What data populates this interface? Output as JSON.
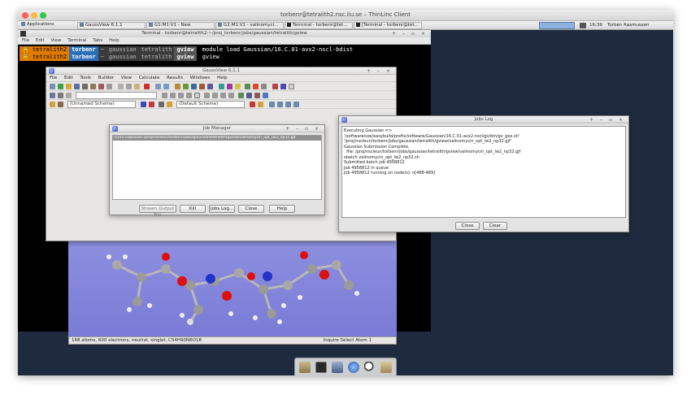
{
  "mac_window": {
    "title": "torbenr@tetralith2.nsc.liu.se – ThinLinc Client"
  },
  "taskbar": {
    "applications": "Applications",
    "tasks": [
      "GaussView 6.1.1",
      "G1:M1:V1 - New",
      "G2:M1:V1 - valinomyci...",
      "Terminal - torbenr@tet...",
      "[Terminal - torbenr@tet..."
    ],
    "clock": "16:39",
    "user": "Torben Rasmussen"
  },
  "terminal": {
    "title": "Terminal - torbenr@tetralith2:~/proj_torbenr/jobs/gaussian/tetralith/gview",
    "menu": [
      "File",
      "Edit",
      "View",
      "Terminal",
      "Tabs",
      "Help"
    ],
    "prompt": {
      "host": "tetralith2",
      "user": "torbenr",
      "tilde": "~",
      "path": [
        "gaussian",
        "tetralith",
        "gview"
      ]
    },
    "lines": [
      "module load Gaussian/16.C.01-avx2-nscl-bdist",
      "gview"
    ],
    "colors": {
      "host": "#e07b00",
      "user": "#2a6fb8",
      "path": "#4a4a4a"
    }
  },
  "gaussview": {
    "title": "GaussView 6.1.1",
    "menu": [
      "File",
      "Edit",
      "Tools",
      "Builder",
      "View",
      "Calculate",
      "Results",
      "Windows",
      "Help"
    ],
    "scheme_left": "(Unnamed Scheme)",
    "scheme_right": "(Default Scheme)"
  },
  "job_manager": {
    "title": "Job Manager",
    "row": "6315  Gaussian /proj/nscleun/torbenr/jobs/gaussian/tetralith/gview/valinomycin_opt_lw2_np32.gjf",
    "buttons": [
      "Stream Output File",
      "Kill",
      "Jobs Log...",
      "Close",
      "Help"
    ]
  },
  "jobs_log": {
    "title": "Jobs Log",
    "lines": [
      "Executing Gaussian =>",
      "'/software/sse/easybuild/prefix/software/Gaussian/16.C.01-avx2-nscl/gv/bin/gv_gex.sh'",
      "'/proj/nscleun/torbenr/jobs/gaussian/tetralith/gview/valinomycin_opt_lw2_np32.gjf'",
      "Gaussian Submission Complete.",
      "  file: /proj/nscleun/torbenr/jobs/gaussian/tetralith/gview/valinomycin_opt_lw2_np32.gjf",
      "sbatch valinomycin_opt_lw2_np32.sh",
      "Submitted batch job 4958812",
      "",
      "Job 4958812 in queue",
      "Job 4958812 running on node(s): n[488-489]"
    ],
    "buttons": [
      "Close",
      "Clear"
    ]
  },
  "molecule_view": {
    "status_left": "168 atoms, 600 electrons, neutral, singlet, C54H90N6O18",
    "status_right": "Inquire  Select Atom 1"
  }
}
